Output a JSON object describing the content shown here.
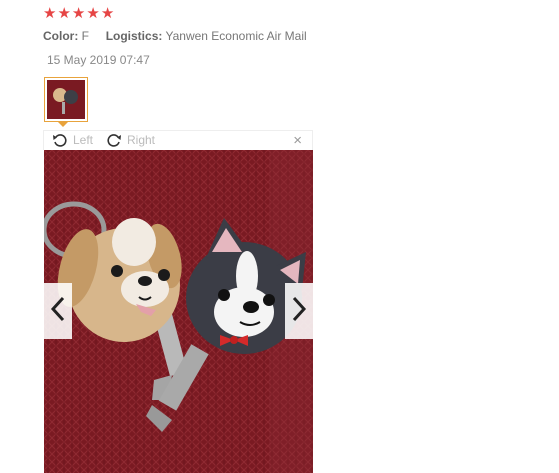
{
  "review": {
    "rating": 5,
    "color_label": "Color:",
    "color_value": "F",
    "logistics_label": "Logistics:",
    "logistics_value": "Yanwen Economic Air Mail",
    "date": "15 May 2019 07:47"
  },
  "viewer": {
    "rotate_left_label": "Left",
    "rotate_right_label": "Right",
    "close_label": "×"
  },
  "colors": {
    "star": "#e64545",
    "thumb_border": "#e8a33c",
    "mat": "#7a1a22"
  },
  "icons": [
    "star-icon",
    "rotate-left-icon",
    "rotate-right-icon",
    "close-icon",
    "chevron-left-icon",
    "chevron-right-icon"
  ]
}
